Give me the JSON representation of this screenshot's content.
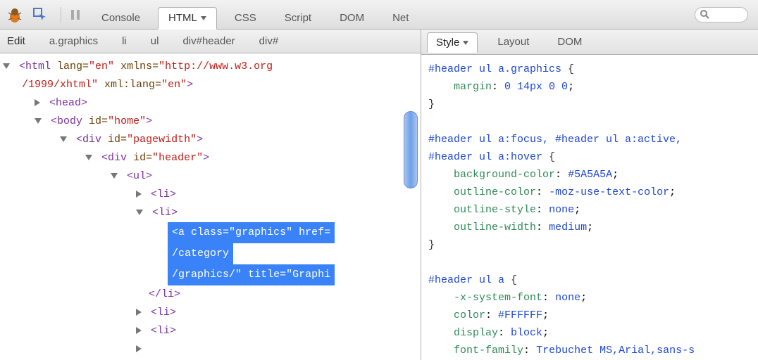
{
  "toolbar": {
    "tabs": [
      "Console",
      "HTML",
      "CSS",
      "Script",
      "DOM",
      "Net"
    ],
    "active_tab": "HTML",
    "search_placeholder": ""
  },
  "breadcrumb": {
    "edit": "Edit",
    "items": [
      "a.graphics",
      "li",
      "ul",
      "div#header",
      "div#"
    ]
  },
  "dom": {
    "l1_open": "<html ",
    "l1_attr1_name": "lang=",
    "l1_attr1_val": "\"en\"",
    "l1_attr2_name": " xmlns=",
    "l1_attr2_val": "\"http://www.w3.org",
    "l2_val": "/1999/xhtml\"",
    "l2_attr_name": " xml:lang=",
    "l2_attr_val": "\"en\"",
    "l2_close": ">",
    "head": "<head>",
    "body_open": "<body ",
    "body_id_name": "id=",
    "body_id_val": "\"home\"",
    "body_close": ">",
    "div1_open": "<div ",
    "div1_name": "id=",
    "div1_val": "\"pagewidth\"",
    "div1_close": ">",
    "div2_open": "<div ",
    "div2_name": "id=",
    "div2_val": "\"header\"",
    "div2_close": ">",
    "ul": "<ul>",
    "li": "<li>",
    "sel1": "<a class=\"graphics\" href=",
    "sel2": "/category",
    "sel3": "/graphics/\" title=\"Graphi",
    "li_close": "</li>"
  },
  "side_panel": {
    "tabs": [
      "Style",
      "Layout",
      "DOM"
    ],
    "active_tab": "Style"
  },
  "css": {
    "r1_sel": "#header ul a.graphics ",
    "r1_p1": "margin",
    "r1_v1": "0 14px 0 0",
    "r2_sel_a": "#header ul a:focus, #header ul a:active,",
    "r2_sel_b": "#header ul a:hover ",
    "r2_p1": "background-color",
    "r2_v1": "#5A5A5A",
    "r2_p2": "outline-color",
    "r2_v2": "-moz-use-text-color",
    "r2_p3": "outline-style",
    "r2_v3": "none",
    "r2_p4": "outline-width",
    "r2_v4": "medium",
    "r3_sel": "#header ul a ",
    "r3_p1": "-x-system-font",
    "r3_v1": "none",
    "r3_p2": "color",
    "r3_v2": "#FFFFFF",
    "r3_p3": "display",
    "r3_v3": "block",
    "r3_p4": "font-family",
    "r3_v4": "Trebuchet MS,Arial,sans-s"
  }
}
